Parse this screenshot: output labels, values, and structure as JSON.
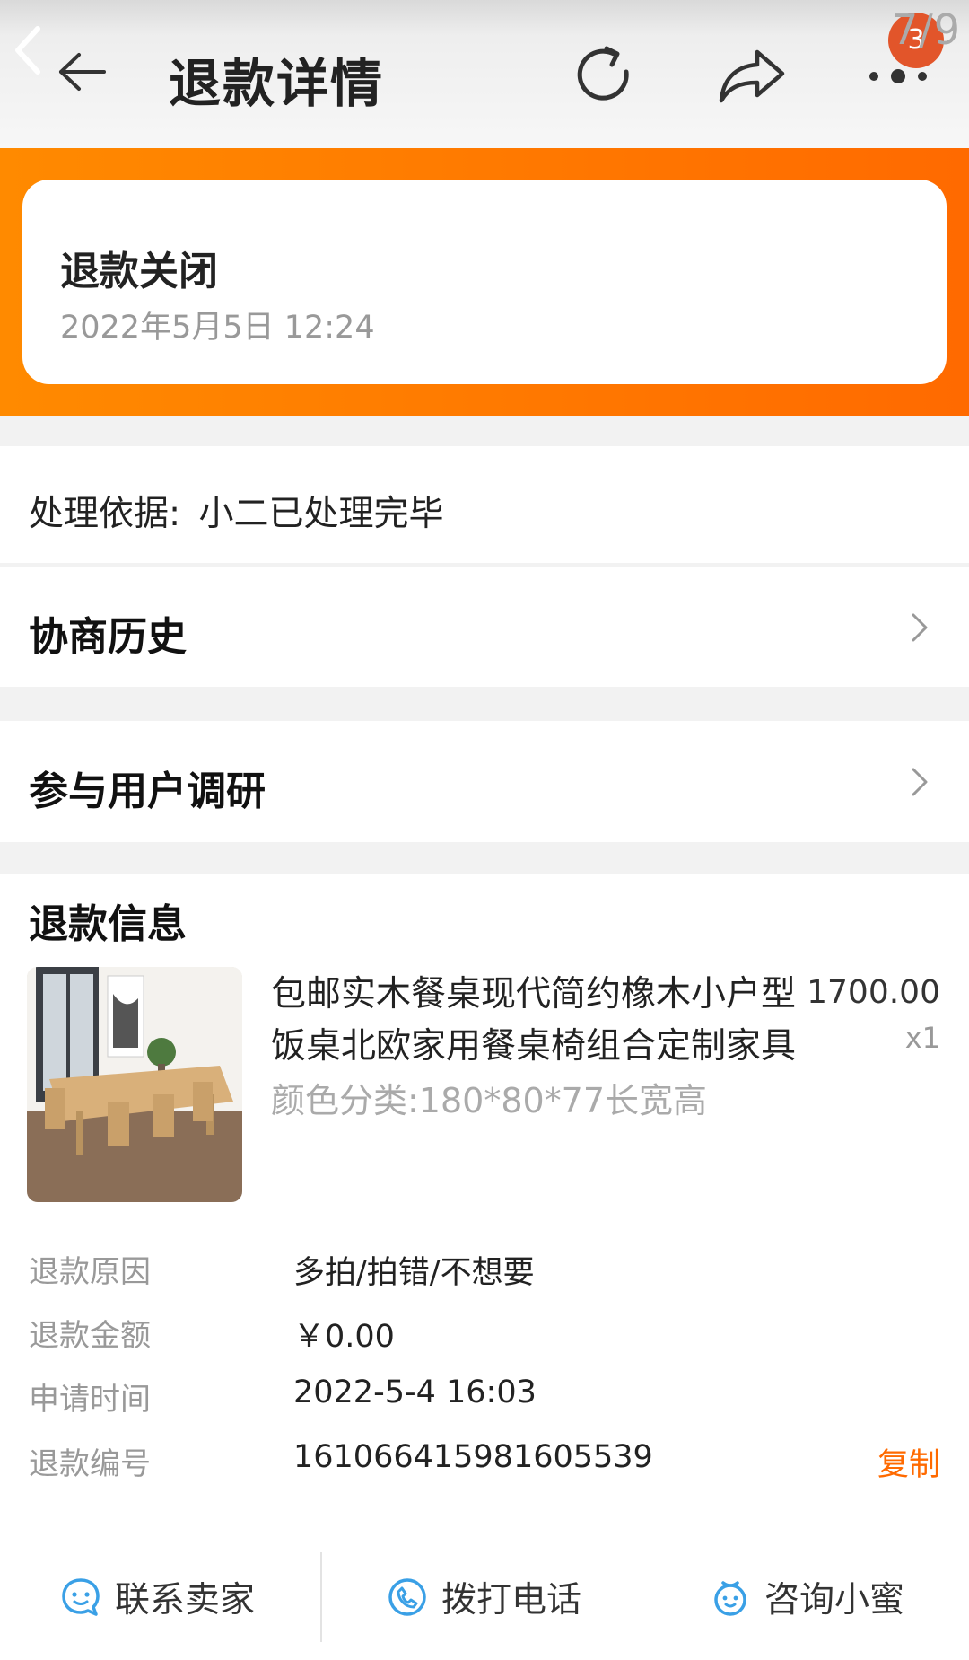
{
  "header": {
    "title": "退款详情",
    "badge": "3",
    "pager": "7/9"
  },
  "status": {
    "title": "退款关闭",
    "time": "2022年5月5日 12:24"
  },
  "basis": {
    "label": "处理依据:",
    "value": "小二已处理完毕"
  },
  "history": {
    "label": "协商历史"
  },
  "survey": {
    "label": "参与用户调研"
  },
  "refund_info": {
    "title": "退款信息",
    "product": {
      "name": "包邮实木餐桌现代简约橡木小户型饭桌北欧家用餐桌椅组合定制家具",
      "spec": "颜色分类:180*80*77长宽高",
      "price": "1700.00",
      "qty": "x1"
    },
    "fields": [
      {
        "label": "退款原因",
        "value": "多拍/拍错/不想要"
      },
      {
        "label": "退款金额",
        "value": "￥0.00"
      },
      {
        "label": "申请时间",
        "value": "2022-5-4 16:03"
      },
      {
        "label": "退款编号",
        "value": "161066415981605539"
      }
    ],
    "copy_label": "复制"
  },
  "bottom_actions": {
    "contact_seller": "联系卖家",
    "call_phone": "拨打电话",
    "consult_xiaomi": "咨询小蜜"
  },
  "colors": {
    "accent": "#ff6a00",
    "badge": "#e2552a"
  }
}
